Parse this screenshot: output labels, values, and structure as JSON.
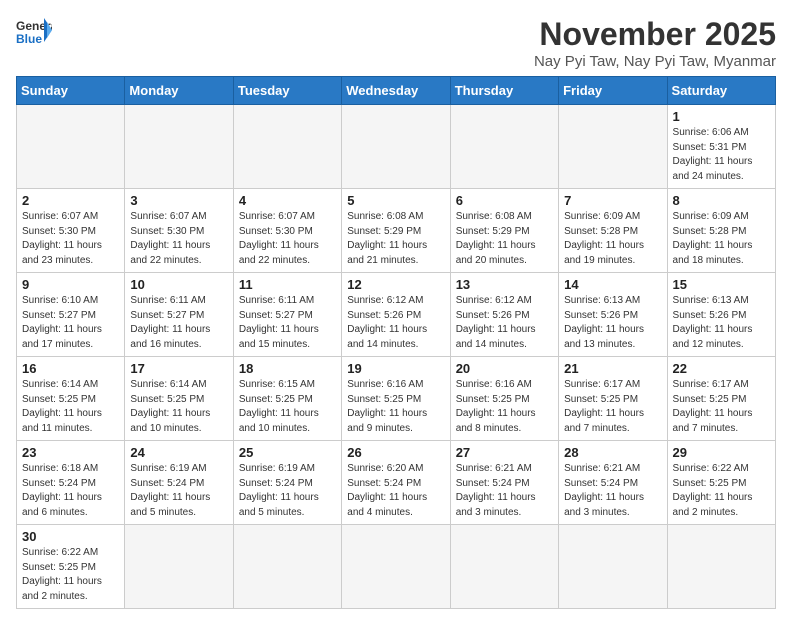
{
  "header": {
    "logo_general": "General",
    "logo_blue": "Blue",
    "month_title": "November 2025",
    "location": "Nay Pyi Taw, Nay Pyi Taw, Myanmar"
  },
  "days_of_week": [
    "Sunday",
    "Monday",
    "Tuesday",
    "Wednesday",
    "Thursday",
    "Friday",
    "Saturday"
  ],
  "weeks": [
    [
      {
        "day": "",
        "info": ""
      },
      {
        "day": "",
        "info": ""
      },
      {
        "day": "",
        "info": ""
      },
      {
        "day": "",
        "info": ""
      },
      {
        "day": "",
        "info": ""
      },
      {
        "day": "",
        "info": ""
      },
      {
        "day": "1",
        "info": "Sunrise: 6:06 AM\nSunset: 5:31 PM\nDaylight: 11 hours\nand 24 minutes."
      }
    ],
    [
      {
        "day": "2",
        "info": "Sunrise: 6:07 AM\nSunset: 5:30 PM\nDaylight: 11 hours\nand 23 minutes."
      },
      {
        "day": "3",
        "info": "Sunrise: 6:07 AM\nSunset: 5:30 PM\nDaylight: 11 hours\nand 22 minutes."
      },
      {
        "day": "4",
        "info": "Sunrise: 6:07 AM\nSunset: 5:30 PM\nDaylight: 11 hours\nand 22 minutes."
      },
      {
        "day": "5",
        "info": "Sunrise: 6:08 AM\nSunset: 5:29 PM\nDaylight: 11 hours\nand 21 minutes."
      },
      {
        "day": "6",
        "info": "Sunrise: 6:08 AM\nSunset: 5:29 PM\nDaylight: 11 hours\nand 20 minutes."
      },
      {
        "day": "7",
        "info": "Sunrise: 6:09 AM\nSunset: 5:28 PM\nDaylight: 11 hours\nand 19 minutes."
      },
      {
        "day": "8",
        "info": "Sunrise: 6:09 AM\nSunset: 5:28 PM\nDaylight: 11 hours\nand 18 minutes."
      }
    ],
    [
      {
        "day": "9",
        "info": "Sunrise: 6:10 AM\nSunset: 5:27 PM\nDaylight: 11 hours\nand 17 minutes."
      },
      {
        "day": "10",
        "info": "Sunrise: 6:11 AM\nSunset: 5:27 PM\nDaylight: 11 hours\nand 16 minutes."
      },
      {
        "day": "11",
        "info": "Sunrise: 6:11 AM\nSunset: 5:27 PM\nDaylight: 11 hours\nand 15 minutes."
      },
      {
        "day": "12",
        "info": "Sunrise: 6:12 AM\nSunset: 5:26 PM\nDaylight: 11 hours\nand 14 minutes."
      },
      {
        "day": "13",
        "info": "Sunrise: 6:12 AM\nSunset: 5:26 PM\nDaylight: 11 hours\nand 14 minutes."
      },
      {
        "day": "14",
        "info": "Sunrise: 6:13 AM\nSunset: 5:26 PM\nDaylight: 11 hours\nand 13 minutes."
      },
      {
        "day": "15",
        "info": "Sunrise: 6:13 AM\nSunset: 5:26 PM\nDaylight: 11 hours\nand 12 minutes."
      }
    ],
    [
      {
        "day": "16",
        "info": "Sunrise: 6:14 AM\nSunset: 5:25 PM\nDaylight: 11 hours\nand 11 minutes."
      },
      {
        "day": "17",
        "info": "Sunrise: 6:14 AM\nSunset: 5:25 PM\nDaylight: 11 hours\nand 10 minutes."
      },
      {
        "day": "18",
        "info": "Sunrise: 6:15 AM\nSunset: 5:25 PM\nDaylight: 11 hours\nand 10 minutes."
      },
      {
        "day": "19",
        "info": "Sunrise: 6:16 AM\nSunset: 5:25 PM\nDaylight: 11 hours\nand 9 minutes."
      },
      {
        "day": "20",
        "info": "Sunrise: 6:16 AM\nSunset: 5:25 PM\nDaylight: 11 hours\nand 8 minutes."
      },
      {
        "day": "21",
        "info": "Sunrise: 6:17 AM\nSunset: 5:25 PM\nDaylight: 11 hours\nand 7 minutes."
      },
      {
        "day": "22",
        "info": "Sunrise: 6:17 AM\nSunset: 5:25 PM\nDaylight: 11 hours\nand 7 minutes."
      }
    ],
    [
      {
        "day": "23",
        "info": "Sunrise: 6:18 AM\nSunset: 5:24 PM\nDaylight: 11 hours\nand 6 minutes."
      },
      {
        "day": "24",
        "info": "Sunrise: 6:19 AM\nSunset: 5:24 PM\nDaylight: 11 hours\nand 5 minutes."
      },
      {
        "day": "25",
        "info": "Sunrise: 6:19 AM\nSunset: 5:24 PM\nDaylight: 11 hours\nand 5 minutes."
      },
      {
        "day": "26",
        "info": "Sunrise: 6:20 AM\nSunset: 5:24 PM\nDaylight: 11 hours\nand 4 minutes."
      },
      {
        "day": "27",
        "info": "Sunrise: 6:21 AM\nSunset: 5:24 PM\nDaylight: 11 hours\nand 3 minutes."
      },
      {
        "day": "28",
        "info": "Sunrise: 6:21 AM\nSunset: 5:24 PM\nDaylight: 11 hours\nand 3 minutes."
      },
      {
        "day": "29",
        "info": "Sunrise: 6:22 AM\nSunset: 5:25 PM\nDaylight: 11 hours\nand 2 minutes."
      }
    ],
    [
      {
        "day": "30",
        "info": "Sunrise: 6:22 AM\nSunset: 5:25 PM\nDaylight: 11 hours\nand 2 minutes."
      },
      {
        "day": "",
        "info": ""
      },
      {
        "day": "",
        "info": ""
      },
      {
        "day": "",
        "info": ""
      },
      {
        "day": "",
        "info": ""
      },
      {
        "day": "",
        "info": ""
      },
      {
        "day": "",
        "info": ""
      }
    ]
  ]
}
